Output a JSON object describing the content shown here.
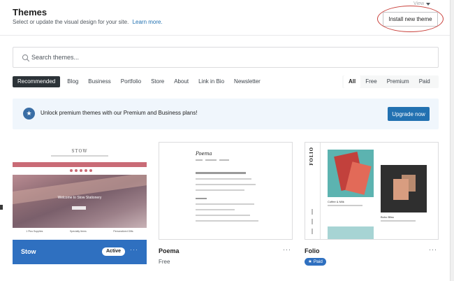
{
  "header": {
    "title": "Themes",
    "subtitle": "Select or update the visual design for your site.",
    "learn_more": "Learn more.",
    "view_label": "View",
    "install_button": "Install new theme"
  },
  "search": {
    "placeholder": "Search themes..."
  },
  "category_tabs": [
    "Recommended",
    "Blog",
    "Business",
    "Portfolio",
    "Store",
    "About",
    "Link in Bio",
    "Newsletter"
  ],
  "price_tabs": [
    "All",
    "Free",
    "Premium",
    "Paid"
  ],
  "banner": {
    "text": "Unlock premium themes with our Premium and Business plans!",
    "button": "Upgrade now"
  },
  "themes": [
    {
      "name": "Stow",
      "badge": "Active",
      "preview": {
        "logo": "STOW",
        "hero_text": "Welcome to Stow Stationery",
        "footer_items": [
          "1 Plus Supplies",
          "Specialty Items",
          "Personalized Gifts"
        ]
      }
    },
    {
      "name": "Poema",
      "price": "Free",
      "preview": {
        "logo": "Poema"
      }
    },
    {
      "name": "Folio",
      "badge": "Paid",
      "preview": {
        "logo": "FOLIO",
        "caption_1": "Coffee & Milk",
        "caption_2": "Boho Bliss"
      }
    }
  ],
  "more_label": "···",
  "colors": {
    "accent": "#2271b1",
    "active_card": "#2f70c0",
    "annotation": "#c9403b",
    "banner_bg": "#f0f6fc"
  }
}
